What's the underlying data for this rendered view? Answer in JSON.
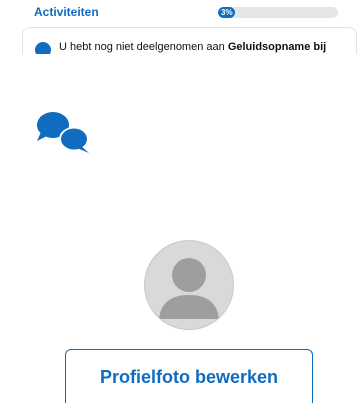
{
  "activities": {
    "title": "Activiteiten",
    "progress_percent": 3,
    "progress_label": "3%"
  },
  "notice": {
    "icon": "info-icon",
    "text_prefix": "U hebt nog niet deelgenomen aan ",
    "text_bold": "Geluidsopname bij"
  },
  "chat": {
    "icon": "chat-bubbles-icon"
  },
  "profile": {
    "avatar_icon": "default-user-avatar-icon",
    "edit_button_label": "Profielfoto bewerken"
  },
  "colors": {
    "accent": "#0f6cbf",
    "progress_track": "#e5e5e5",
    "avatar_bg": "#d9d9d9",
    "avatar_figure": "#9e9e9e"
  }
}
